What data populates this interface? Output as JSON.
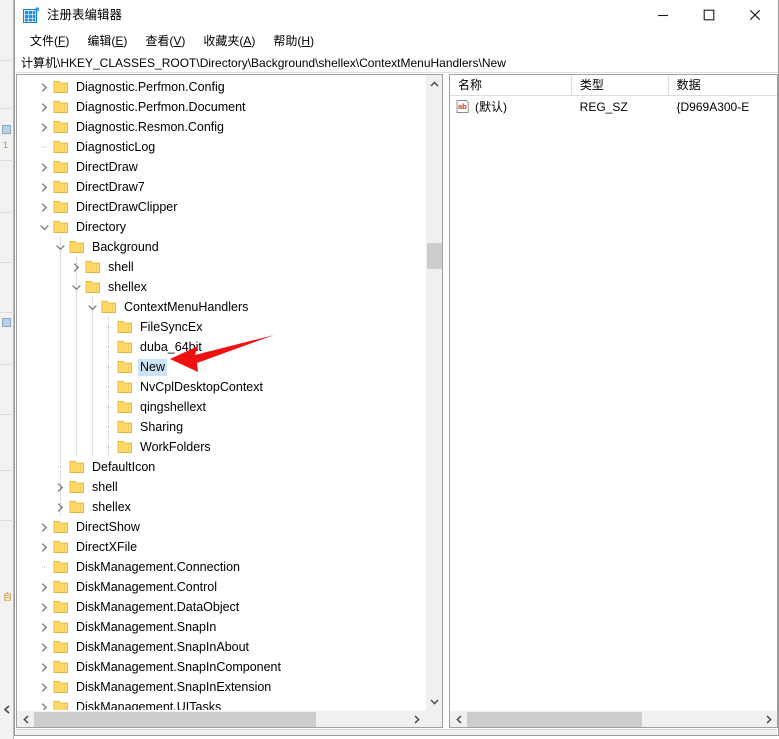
{
  "window": {
    "title": "注册表编辑器",
    "icon": "registry-grid-icon",
    "controls": {
      "minimize": "minimize-icon",
      "maximize": "maximize-icon",
      "close": "close-icon"
    }
  },
  "menubar": {
    "items": [
      {
        "label": "文件(F)",
        "text": "文件(",
        "accel": "F",
        "tail": ")"
      },
      {
        "label": "编辑(E)",
        "text": "编辑(",
        "accel": "E",
        "tail": ")"
      },
      {
        "label": "查看(V)",
        "text": "查看(",
        "accel": "V",
        "tail": ")"
      },
      {
        "label": "收藏夹(A)",
        "text": "收藏夹(",
        "accel": "A",
        "tail": ")"
      },
      {
        "label": "帮助(H)",
        "text": "帮助(",
        "accel": "H",
        "tail": ")"
      }
    ]
  },
  "address": {
    "path": "计算机\\HKEY_CLASSES_ROOT\\Directory\\Background\\shellex\\ContextMenuHandlers\\New"
  },
  "tree": {
    "items": [
      {
        "label": "Diagnostic.Perfmon.Config",
        "depth": 1,
        "state": "collapsed"
      },
      {
        "label": "Diagnostic.Perfmon.Document",
        "depth": 1,
        "state": "collapsed"
      },
      {
        "label": "Diagnostic.Resmon.Config",
        "depth": 1,
        "state": "collapsed"
      },
      {
        "label": "DiagnosticLog",
        "depth": 1,
        "state": "leaf"
      },
      {
        "label": "DirectDraw",
        "depth": 1,
        "state": "collapsed"
      },
      {
        "label": "DirectDraw7",
        "depth": 1,
        "state": "collapsed"
      },
      {
        "label": "DirectDrawClipper",
        "depth": 1,
        "state": "collapsed"
      },
      {
        "label": "Directory",
        "depth": 1,
        "state": "expanded"
      },
      {
        "label": "Background",
        "depth": 2,
        "state": "expanded"
      },
      {
        "label": "shell",
        "depth": 3,
        "state": "collapsed"
      },
      {
        "label": "shellex",
        "depth": 3,
        "state": "expanded"
      },
      {
        "label": "ContextMenuHandlers",
        "depth": 4,
        "state": "expanded"
      },
      {
        "label": "FileSyncEx",
        "depth": 5,
        "state": "leaf"
      },
      {
        "label": "duba_64bit",
        "depth": 5,
        "state": "leaf"
      },
      {
        "label": "New",
        "depth": 5,
        "state": "leaf",
        "selected": true
      },
      {
        "label": "NvCplDesktopContext",
        "depth": 5,
        "state": "leaf"
      },
      {
        "label": "qingshellext",
        "depth": 5,
        "state": "leaf"
      },
      {
        "label": "Sharing",
        "depth": 5,
        "state": "leaf"
      },
      {
        "label": "WorkFolders",
        "depth": 5,
        "state": "leaf"
      },
      {
        "label": "DefaultIcon",
        "depth": 2,
        "state": "leaf"
      },
      {
        "label": "shell",
        "depth": 2,
        "state": "collapsed"
      },
      {
        "label": "shellex",
        "depth": 2,
        "state": "collapsed"
      },
      {
        "label": "DirectShow",
        "depth": 1,
        "state": "collapsed"
      },
      {
        "label": "DirectXFile",
        "depth": 1,
        "state": "collapsed"
      },
      {
        "label": "DiskManagement.Connection",
        "depth": 1,
        "state": "leaf"
      },
      {
        "label": "DiskManagement.Control",
        "depth": 1,
        "state": "collapsed"
      },
      {
        "label": "DiskManagement.DataObject",
        "depth": 1,
        "state": "collapsed"
      },
      {
        "label": "DiskManagement.SnapIn",
        "depth": 1,
        "state": "collapsed"
      },
      {
        "label": "DiskManagement.SnapInAbout",
        "depth": 1,
        "state": "collapsed"
      },
      {
        "label": "DiskManagement.SnapInComponent",
        "depth": 1,
        "state": "collapsed"
      },
      {
        "label": "DiskManagement.SnapInExtension",
        "depth": 1,
        "state": "collapsed"
      },
      {
        "label": "DiskManagement.UITasks",
        "depth": 1,
        "state": "collapsed"
      }
    ]
  },
  "list": {
    "columns": [
      "名称",
      "类型",
      "数据"
    ],
    "rows": [
      {
        "name": "(默认)",
        "type": "REG_SZ",
        "data": "{D969A300-E",
        "icon": "string-value-icon"
      }
    ]
  },
  "colors": {
    "selection": "#cce4f7",
    "folder": "#ffd966",
    "annotation": "#ee1111",
    "scrollbar_thumb": "#cdcdcd"
  }
}
